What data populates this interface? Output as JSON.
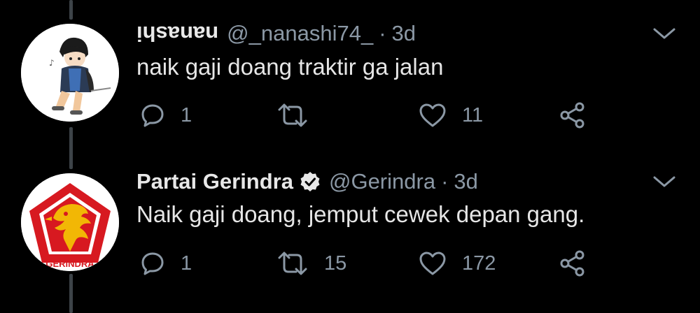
{
  "colors": {
    "background": "#000000",
    "text": "#e6e6e6",
    "secondary": "#8b98a5",
    "thread_line": "#3d4348",
    "gerindra_red": "#d71920",
    "gerindra_gold": "#f2b705"
  },
  "tweets": [
    {
      "name": "nanashi",
      "handle": "@_nanashi74_",
      "dot": "·",
      "time": "3d",
      "text": "naik gaji doang traktir ga jalan",
      "replies": "1",
      "retweets": "",
      "likes": "11",
      "avatar_icon": "anime-boy-sitting-avatar"
    },
    {
      "name": "Partai Gerindra",
      "verified": true,
      "handle": "@Gerindra",
      "dot": "·",
      "time": "3d",
      "text": "Naik gaji doang, jemput cewek depan gang.",
      "replies": "1",
      "retweets": "15",
      "likes": "172",
      "avatar_logo_text": "GERINDRA"
    }
  ]
}
